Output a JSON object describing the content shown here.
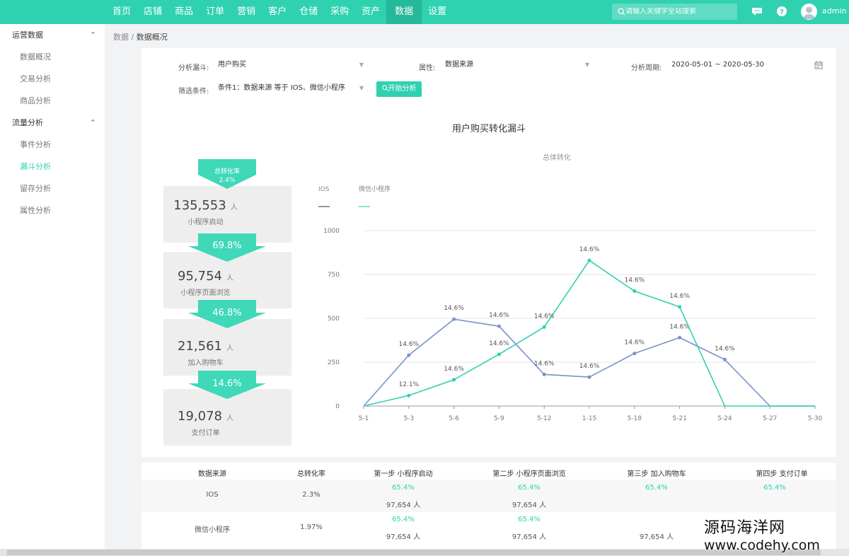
{
  "nav": {
    "items": [
      "首页",
      "店铺",
      "商品",
      "订单",
      "营销",
      "客户",
      "仓储",
      "采购",
      "资产",
      "数据",
      "设置"
    ],
    "active_index": 9,
    "search_placeholder": "请输入关键字全站搜索",
    "user": "admin"
  },
  "sidebar": {
    "groups": [
      {
        "title": "运营数据",
        "items": [
          "数据概况",
          "交易分析",
          "商品分析"
        ]
      },
      {
        "title": "流量分析",
        "items": [
          "事件分析",
          "漏斗分析",
          "留存分析",
          "属性分析"
        ]
      }
    ],
    "active_item": "漏斗分析"
  },
  "breadcrumb": {
    "parent": "数据",
    "sep": "/",
    "current": "数据概况"
  },
  "filters": {
    "funnel_label": "分析漏斗:",
    "funnel_value": "用户购买",
    "attr_label": "属性:",
    "attr_value": "数据来源",
    "period_label": "分析周期:",
    "period_start": "2020-05-01",
    "period_sep": "~",
    "period_end": "2020-05-30",
    "condition_label": "筛选条件:",
    "condition_value": "条件1：数据来源 等于 IOS、微信小程序",
    "start_button": "开始分析"
  },
  "chart_title": "用户购买转化漏斗",
  "funnel": {
    "total_label": "总转化率",
    "total_rate": "2.4%",
    "steps": [
      {
        "value": "135,553",
        "unit": "人",
        "label": "小程序启动"
      },
      {
        "value": "95,754",
        "unit": "人",
        "label": "小程序页面浏览"
      },
      {
        "value": "21,561",
        "unit": "人",
        "label": "加入购物车"
      },
      {
        "value": "19,078",
        "unit": "人",
        "label": "支付订单"
      }
    ],
    "rates": [
      "69.8%",
      "46.8%",
      "14.6%"
    ]
  },
  "colors": {
    "accent": "#2fd1b0",
    "ios": "#7b93c9",
    "wechat": "#2fd1b0"
  },
  "chart_data": {
    "type": "line",
    "title": "总体转化",
    "x": [
      "5-1",
      "5-3",
      "5-6",
      "5-9",
      "5-12",
      "1-15",
      "5-18",
      "5-21",
      "5-24",
      "5-27",
      "5-30"
    ],
    "ylim": [
      0,
      1000
    ],
    "yticks": [
      0,
      250,
      500,
      750,
      1000
    ],
    "grid": true,
    "legend": "top-left",
    "series": [
      {
        "name": "IOS",
        "color": "#7b93c9",
        "values": [
          0,
          290,
          495,
          455,
          180,
          165,
          300,
          390,
          265,
          0,
          0
        ],
        "labels": [
          "",
          "14.6%",
          "14.6%",
          "14.6%",
          "14.6%",
          "14.6%",
          "14.6%",
          "14.6%",
          "14.6%",
          "",
          ""
        ]
      },
      {
        "name": "微信小程序",
        "color": "#2fd1b0",
        "values": [
          0,
          60,
          150,
          295,
          450,
          830,
          655,
          565,
          0,
          0,
          0
        ],
        "labels": [
          "",
          "12.1%",
          "14.6%",
          "14.6%",
          "14.6%",
          "14.6%",
          "14.6%",
          "14.6%",
          "",
          "",
          ""
        ]
      }
    ]
  },
  "table": {
    "headers": [
      "数据来源",
      "总转化率",
      "第一步 小程序启动",
      "第二步 小程序页面浏览",
      "第三步 加入购物车",
      "第四步 支付订单"
    ],
    "rows": [
      {
        "source": "IOS",
        "rate": "2.3%",
        "steps": [
          {
            "pct": "65.4%",
            "count": "97,654 人"
          },
          {
            "pct": "65.4%",
            "count": "97,654 人"
          },
          {
            "pct": "65.4%",
            "count": ""
          },
          {
            "pct": "65.4%",
            "count": ""
          }
        ]
      },
      {
        "source": "微信小程序",
        "rate": "1.97%",
        "steps": [
          {
            "pct": "65.4%",
            "count": "97,654 人"
          },
          {
            "pct": "65.4%",
            "count": "97,654 人"
          },
          {
            "pct": "",
            "count": "97,654 人"
          },
          {
            "pct": "",
            "count": ""
          }
        ]
      }
    ]
  },
  "watermark": {
    "line1": "源码海洋网",
    "line2": "www.codehy.com"
  }
}
